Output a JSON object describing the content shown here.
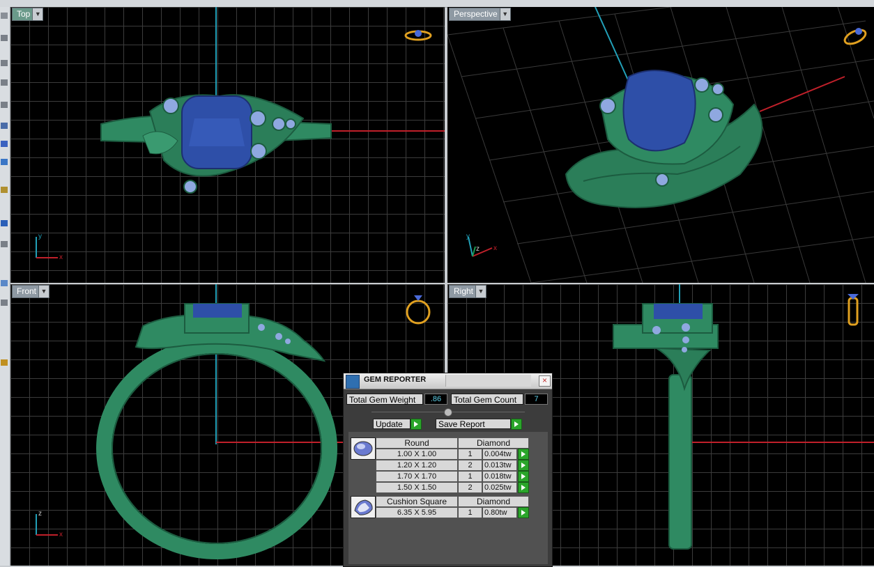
{
  "viewports": {
    "top": {
      "label": "Top",
      "axis_x": "x",
      "axis_y": "y"
    },
    "perspective": {
      "label": "Perspective",
      "axis_x": "x",
      "axis_y": "y",
      "axis_z": "z"
    },
    "front": {
      "label": "Front",
      "axis_x": "x",
      "axis_z": "z"
    },
    "right": {
      "label": "Right"
    }
  },
  "gem_reporter": {
    "title": "GEM REPORTER",
    "close_icon": "close-icon",
    "total_gem_weight_label": "Total Gem Weight",
    "total_gem_weight": ".86",
    "total_gem_count_label": "Total Gem Count",
    "total_gem_count": "7",
    "update_label": "Update",
    "save_report_label": "Save Report",
    "groups": [
      {
        "shape": "Round",
        "material": "Diamond",
        "rows": [
          {
            "size": "1.00 X 1.00",
            "count": "1",
            "weight": "0.004tw"
          },
          {
            "size": "1.20 X 1.20",
            "count": "2",
            "weight": "0.013tw"
          },
          {
            "size": "1.70 X 1.70",
            "count": "1",
            "weight": "0.018tw"
          },
          {
            "size": "1.50 X 1.50",
            "count": "2",
            "weight": "0.025tw"
          }
        ]
      },
      {
        "shape": "Cushion Square",
        "material": "Diamond",
        "rows": [
          {
            "size": "6.35 X 5.95",
            "count": "1",
            "weight": "0.80tw"
          }
        ]
      }
    ]
  },
  "colors": {
    "metal": "#2f8a62",
    "gem": "#2e4fa8",
    "small_gem": "#8fa8e0",
    "x_axis": "#c0202a",
    "y_axis": "#22a0b8",
    "viewport_bg": "#000000"
  }
}
